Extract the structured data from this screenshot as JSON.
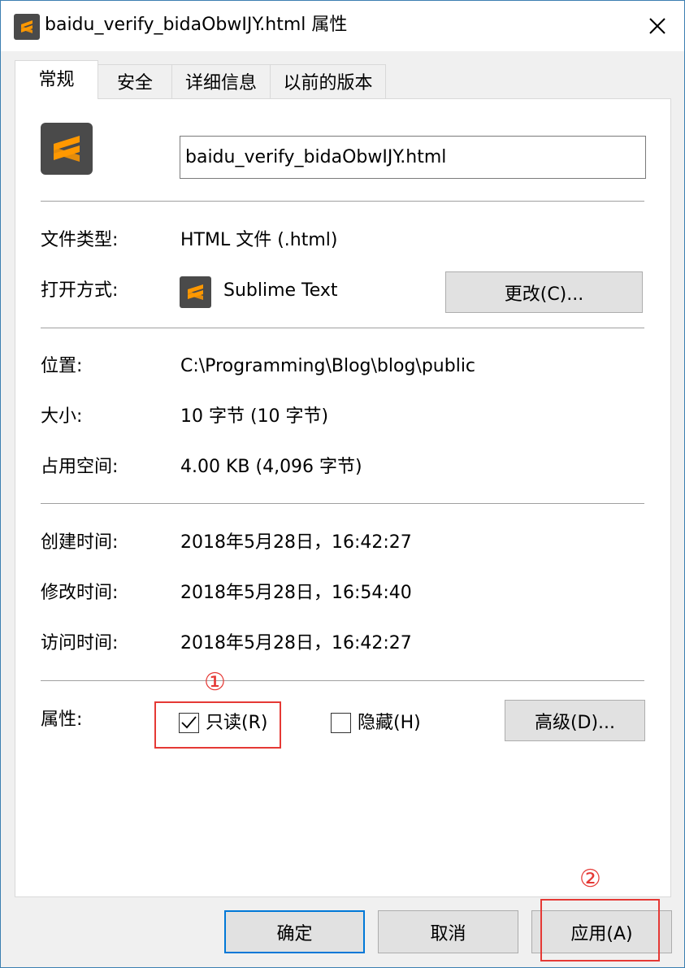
{
  "window": {
    "title": "baidu_verify_bidaObwIJY.html 属性",
    "close_icon": "close-icon"
  },
  "tabs": [
    {
      "label": "常规",
      "active": true
    },
    {
      "label": "安全",
      "active": false
    },
    {
      "label": "详细信息",
      "active": false
    },
    {
      "label": "以前的版本",
      "active": false
    }
  ],
  "general": {
    "app_icon": "sublime-text-icon",
    "filename": "baidu_verify_bidaObwIJY.html",
    "file_type_label": "文件类型:",
    "file_type_value": "HTML 文件 (.html)",
    "open_with_label": "打开方式:",
    "open_with_value": "Sublime Text",
    "change_button": "更改(C)...",
    "location_label": "位置:",
    "location_value": "C:\\Programming\\Blog\\blog\\public",
    "size_label": "大小:",
    "size_value": "10 字节 (10 字节)",
    "size_on_disk_label": "占用空间:",
    "size_on_disk_value": "4.00 KB (4,096 字节)",
    "created_label": "创建时间:",
    "created_value": "2018年5月28日，16:42:27",
    "modified_label": "修改时间:",
    "modified_value": "2018年5月28日，16:54:40",
    "accessed_label": "访问时间:",
    "accessed_value": "2018年5月28日，16:42:27",
    "attributes_label": "属性:",
    "readonly_label": "只读(R)",
    "readonly_checked": true,
    "hidden_label": "隐藏(H)",
    "hidden_checked": false,
    "advanced_button": "高级(D)..."
  },
  "footer": {
    "ok_button": "确定",
    "cancel_button": "取消",
    "apply_button": "应用(A)"
  },
  "annotations": {
    "marker_1": "①",
    "marker_2": "②",
    "color": "#e53935"
  },
  "colors": {
    "accent": "#0078d7",
    "sublime_orange": "#ff9800",
    "sublime_bg": "#4a4a4a"
  }
}
